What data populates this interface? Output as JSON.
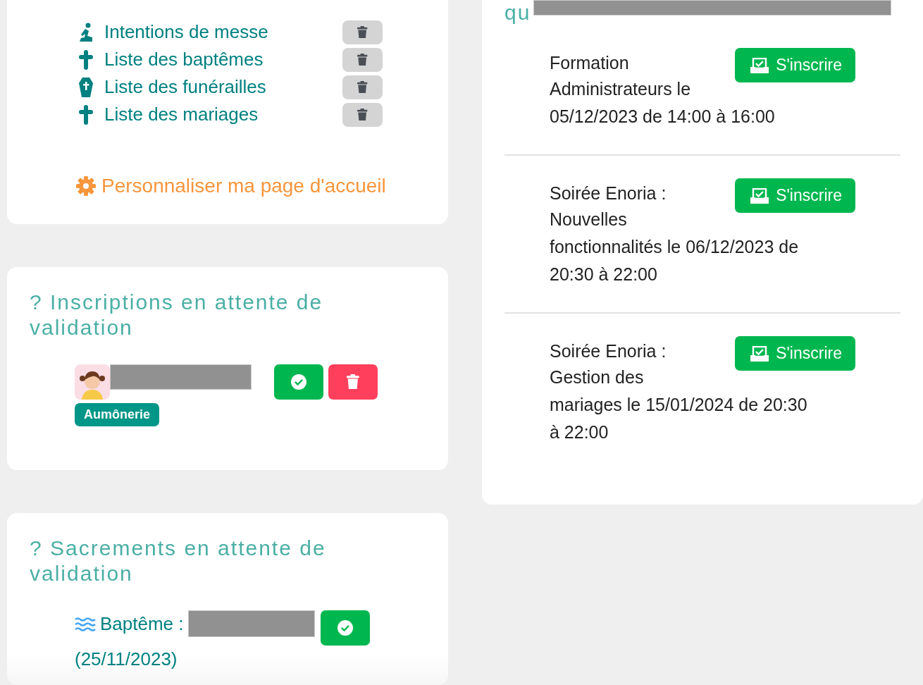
{
  "lists_card": {
    "items": [
      {
        "kind": "praying",
        "label": "Intentions de messe"
      },
      {
        "kind": "cross",
        "label": "Liste des baptêmes"
      },
      {
        "kind": "coffin",
        "label": "Liste des funérailles"
      },
      {
        "kind": "cross",
        "label": "Liste des mariages"
      }
    ],
    "customize_link": "Personnaliser ma page d'accueil"
  },
  "registrations_card": {
    "title": "? Inscriptions en attente de validation",
    "entries": [
      {
        "badge": "Aumônerie"
      }
    ]
  },
  "sacraments_card": {
    "title": "? Sacrements en attente de validation",
    "entries": [
      {
        "kind": "baptism",
        "label": "Baptême :",
        "date": "(25/11/2023)"
      }
    ]
  },
  "events_card": {
    "title": "qu",
    "events": [
      {
        "lines": [
          "Formation",
          "Administrateurs le",
          "05/12/2023 de 14:00 à 16:00"
        ],
        "button": "S'inscrire"
      },
      {
        "lines": [
          "Soirée Enoria :",
          "Nouvelles",
          "fonctionnalités le 06/12/2023 de",
          "20:30 à 22:00"
        ],
        "button": "S'inscrire"
      },
      {
        "lines": [
          "Soirée Enoria :",
          "Gestion des",
          "mariages le 15/01/2024 de 20:30",
          "à 22:00"
        ],
        "button": "S'inscrire"
      }
    ]
  }
}
